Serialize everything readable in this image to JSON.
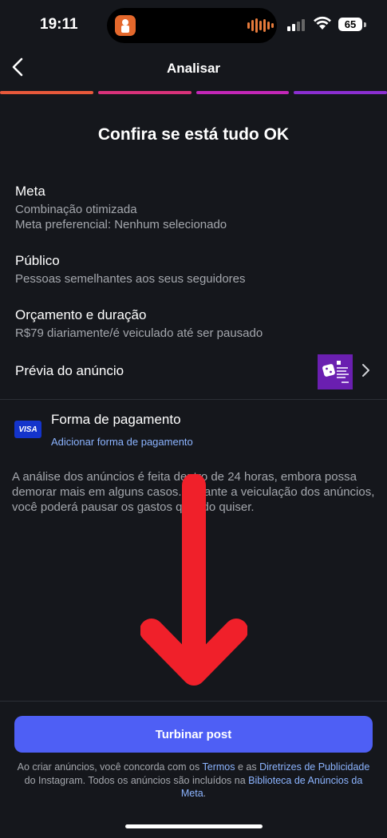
{
  "status": {
    "time": "19:11",
    "battery": "65"
  },
  "header": {
    "title": "Analisar",
    "progress_colors": [
      "#e8593b",
      "#d9327a",
      "#c327b7",
      "#8b2fd1"
    ]
  },
  "main": {
    "heading": "Confira se está tudo OK",
    "sections": [
      {
        "title": "Meta",
        "lines": [
          "Combinação otimizada",
          "Meta preferencial: Nenhum selecionado"
        ]
      },
      {
        "title": "Público",
        "lines": [
          "Pessoas semelhantes aos seus seguidores"
        ]
      },
      {
        "title": "Orçamento e duração",
        "lines": [
          "R$79 diariamente/é veiculado até ser pausado"
        ]
      },
      {
        "title": "Prévia do anúncio",
        "lines": []
      }
    ],
    "payment": {
      "card_brand": "VISA",
      "title": "Forma de pagamento",
      "link": "Adicionar forma de pagamento"
    },
    "notice": "A análise dos anúncios é feita dentro de 24 horas, embora possa demorar mais em alguns casos. Durante a veiculação dos anúncios, você poderá pausar os gastos quando quiser."
  },
  "footer": {
    "cta": "Turbinar post",
    "legal_1": "Ao criar anúncios, você concorda com os ",
    "terms": "Termos",
    "legal_2": " e as ",
    "guidelines": "Diretrizes de Publicidade",
    "legal_3": " do Instagram. Todos os anúncios são incluídos na ",
    "library": "Biblioteca de Anúncios da Meta",
    "legal_4": "."
  },
  "colors": {
    "background": "#15171c",
    "accent": "#4e5ff5",
    "link": "#8cb4ff",
    "annotation_arrow": "#f0202a"
  }
}
